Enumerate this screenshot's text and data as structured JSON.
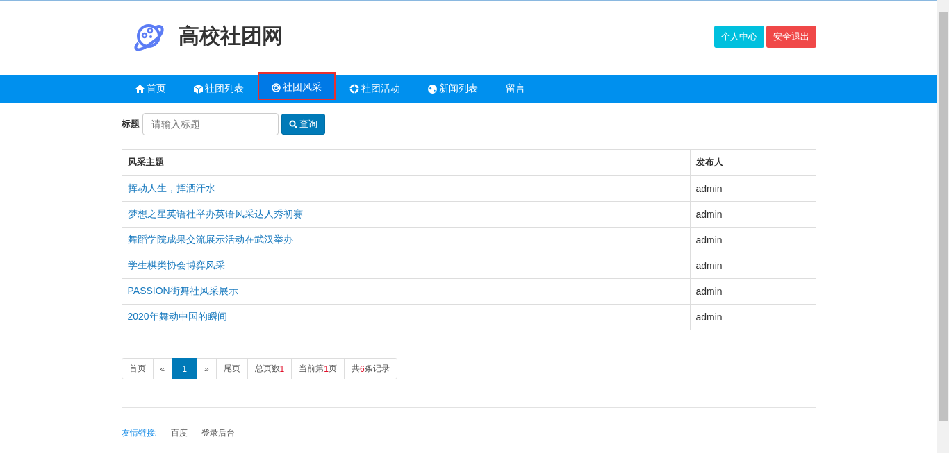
{
  "header": {
    "site_title": "高校社团网",
    "buttons": [
      {
        "label": "个人中心",
        "kind": "info"
      },
      {
        "label": "安全退出",
        "kind": "danger"
      }
    ]
  },
  "nav": [
    {
      "label": "首页",
      "kind": "home",
      "selected": false
    },
    {
      "label": "社团列表",
      "kind": "cube",
      "selected": false
    },
    {
      "label": "社团风采",
      "kind": "target",
      "selected": true
    },
    {
      "label": "社团活动",
      "kind": "ring",
      "selected": false
    },
    {
      "label": "新闻列表",
      "kind": "globe",
      "selected": false
    },
    {
      "label": "留言",
      "kind": "plain",
      "selected": false
    }
  ],
  "search": {
    "label": "标题",
    "placeholder": "请输入标题",
    "button": "查询"
  },
  "table": {
    "columns": [
      "风采主题",
      "发布人"
    ],
    "rows": [
      {
        "title": "挥动人生，挥洒汗水",
        "author": "admin"
      },
      {
        "title": "梦想之星英语社举办英语风采达人秀初赛",
        "author": "admin"
      },
      {
        "title": "舞蹈学院成果交流展示活动在武汉举办",
        "author": "admin"
      },
      {
        "title": "学生棋类协会博弈风采",
        "author": "admin"
      },
      {
        "title": "PASSION街舞社风采展示",
        "author": "admin"
      },
      {
        "title": "2020年舞动中国的瞬间",
        "author": "admin"
      }
    ]
  },
  "pagination": {
    "links": [
      {
        "label": "首页",
        "selected": false
      },
      {
        "label": "«",
        "selected": false
      },
      {
        "label": "1",
        "selected": true
      },
      {
        "label": "»",
        "selected": false
      },
      {
        "label": "尾页",
        "selected": false
      }
    ],
    "info": [
      {
        "before": "总页数",
        "value": "1"
      },
      {
        "before": "当前第",
        "value": "1",
        "after": "页"
      },
      {
        "before": "共",
        "value": "6",
        "after": "条记录"
      }
    ]
  },
  "footer": {
    "label": "友情链接:",
    "links": [
      "百度",
      "登录后台"
    ]
  }
}
